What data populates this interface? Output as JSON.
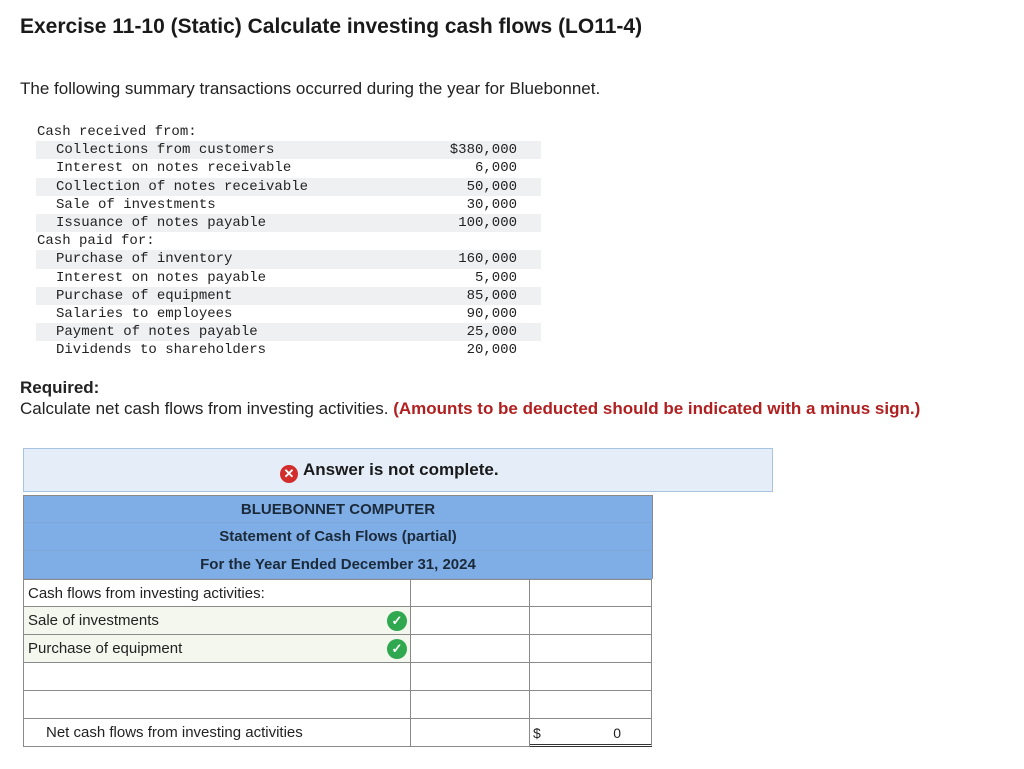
{
  "header": {
    "title": "Exercise 11-10 (Static) Calculate investing cash flows (LO11-4)",
    "intro": "The following summary transactions occurred during the year for Bluebonnet."
  },
  "transactions": {
    "received_heading": "Cash received from:",
    "received": [
      {
        "label": "Collections from customers",
        "amount": "$380,000"
      },
      {
        "label": "Interest on notes receivable",
        "amount": "6,000"
      },
      {
        "label": "Collection of notes receivable",
        "amount": "50,000"
      },
      {
        "label": "Sale of investments",
        "amount": "30,000"
      },
      {
        "label": "Issuance of notes payable",
        "amount": "100,000"
      }
    ],
    "paid_heading": "Cash paid for:",
    "paid": [
      {
        "label": "Purchase of inventory",
        "amount": "160,000"
      },
      {
        "label": "Interest on notes payable",
        "amount": "5,000"
      },
      {
        "label": "Purchase of equipment",
        "amount": "85,000"
      },
      {
        "label": "Salaries to employees",
        "amount": "90,000"
      },
      {
        "label": "Payment of notes payable",
        "amount": "25,000"
      },
      {
        "label": "Dividends to shareholders",
        "amount": "20,000"
      }
    ]
  },
  "required": {
    "title": "Required:",
    "text": "Calculate net cash flows from investing activities.",
    "note": "(Amounts to be deducted should be indicated with a minus sign.)"
  },
  "banner": {
    "icon": "x-circle-icon",
    "text": "Answer is not complete.",
    "color": "#d22c2c"
  },
  "statement": {
    "company": "BLUEBONNET COMPUTER",
    "name": "Statement of Cash Flows (partial)",
    "period": "For the Year Ended December 31, 2024",
    "section_label": "Cash flows from investing activities:",
    "row1_label": "Sale of investments",
    "row2_label": "Purchase of equipment",
    "row1_mid": "",
    "row2_mid": "",
    "row3_label": "",
    "row4_label": "",
    "total_label": "Net cash flows from investing activities",
    "total_currency": "$",
    "total_value": "0",
    "header_color": "#7faee6",
    "check_color": "#2fa84f"
  }
}
